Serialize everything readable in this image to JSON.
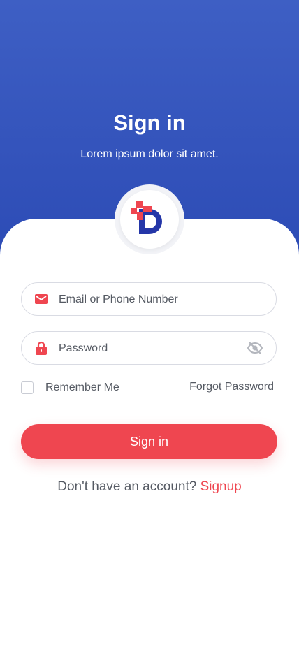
{
  "header": {
    "title": "Sign in",
    "subtitle": "Lorem ipsum dolor sit amet."
  },
  "logo": {
    "icon": "brand-logo-icon",
    "colors": {
      "red": "#ef4650",
      "blue": "#2436a8"
    }
  },
  "form": {
    "email": {
      "placeholder": "Email or Phone Number",
      "value": "",
      "icon": "mail-icon"
    },
    "password": {
      "placeholder": "Password",
      "value": "",
      "icon": "lock-icon",
      "toggle_icon": "eye-off-icon"
    },
    "remember_label": "Remember Me",
    "remember_checked": false,
    "forgot_label": "Forgot Password",
    "submit_label": "Sign in"
  },
  "footer": {
    "prompt": "Don't have an account?",
    "link": "Signup"
  },
  "colors": {
    "primary_blue": "#3350bd",
    "accent_red": "#ef4650",
    "text_gray": "#555a63"
  }
}
